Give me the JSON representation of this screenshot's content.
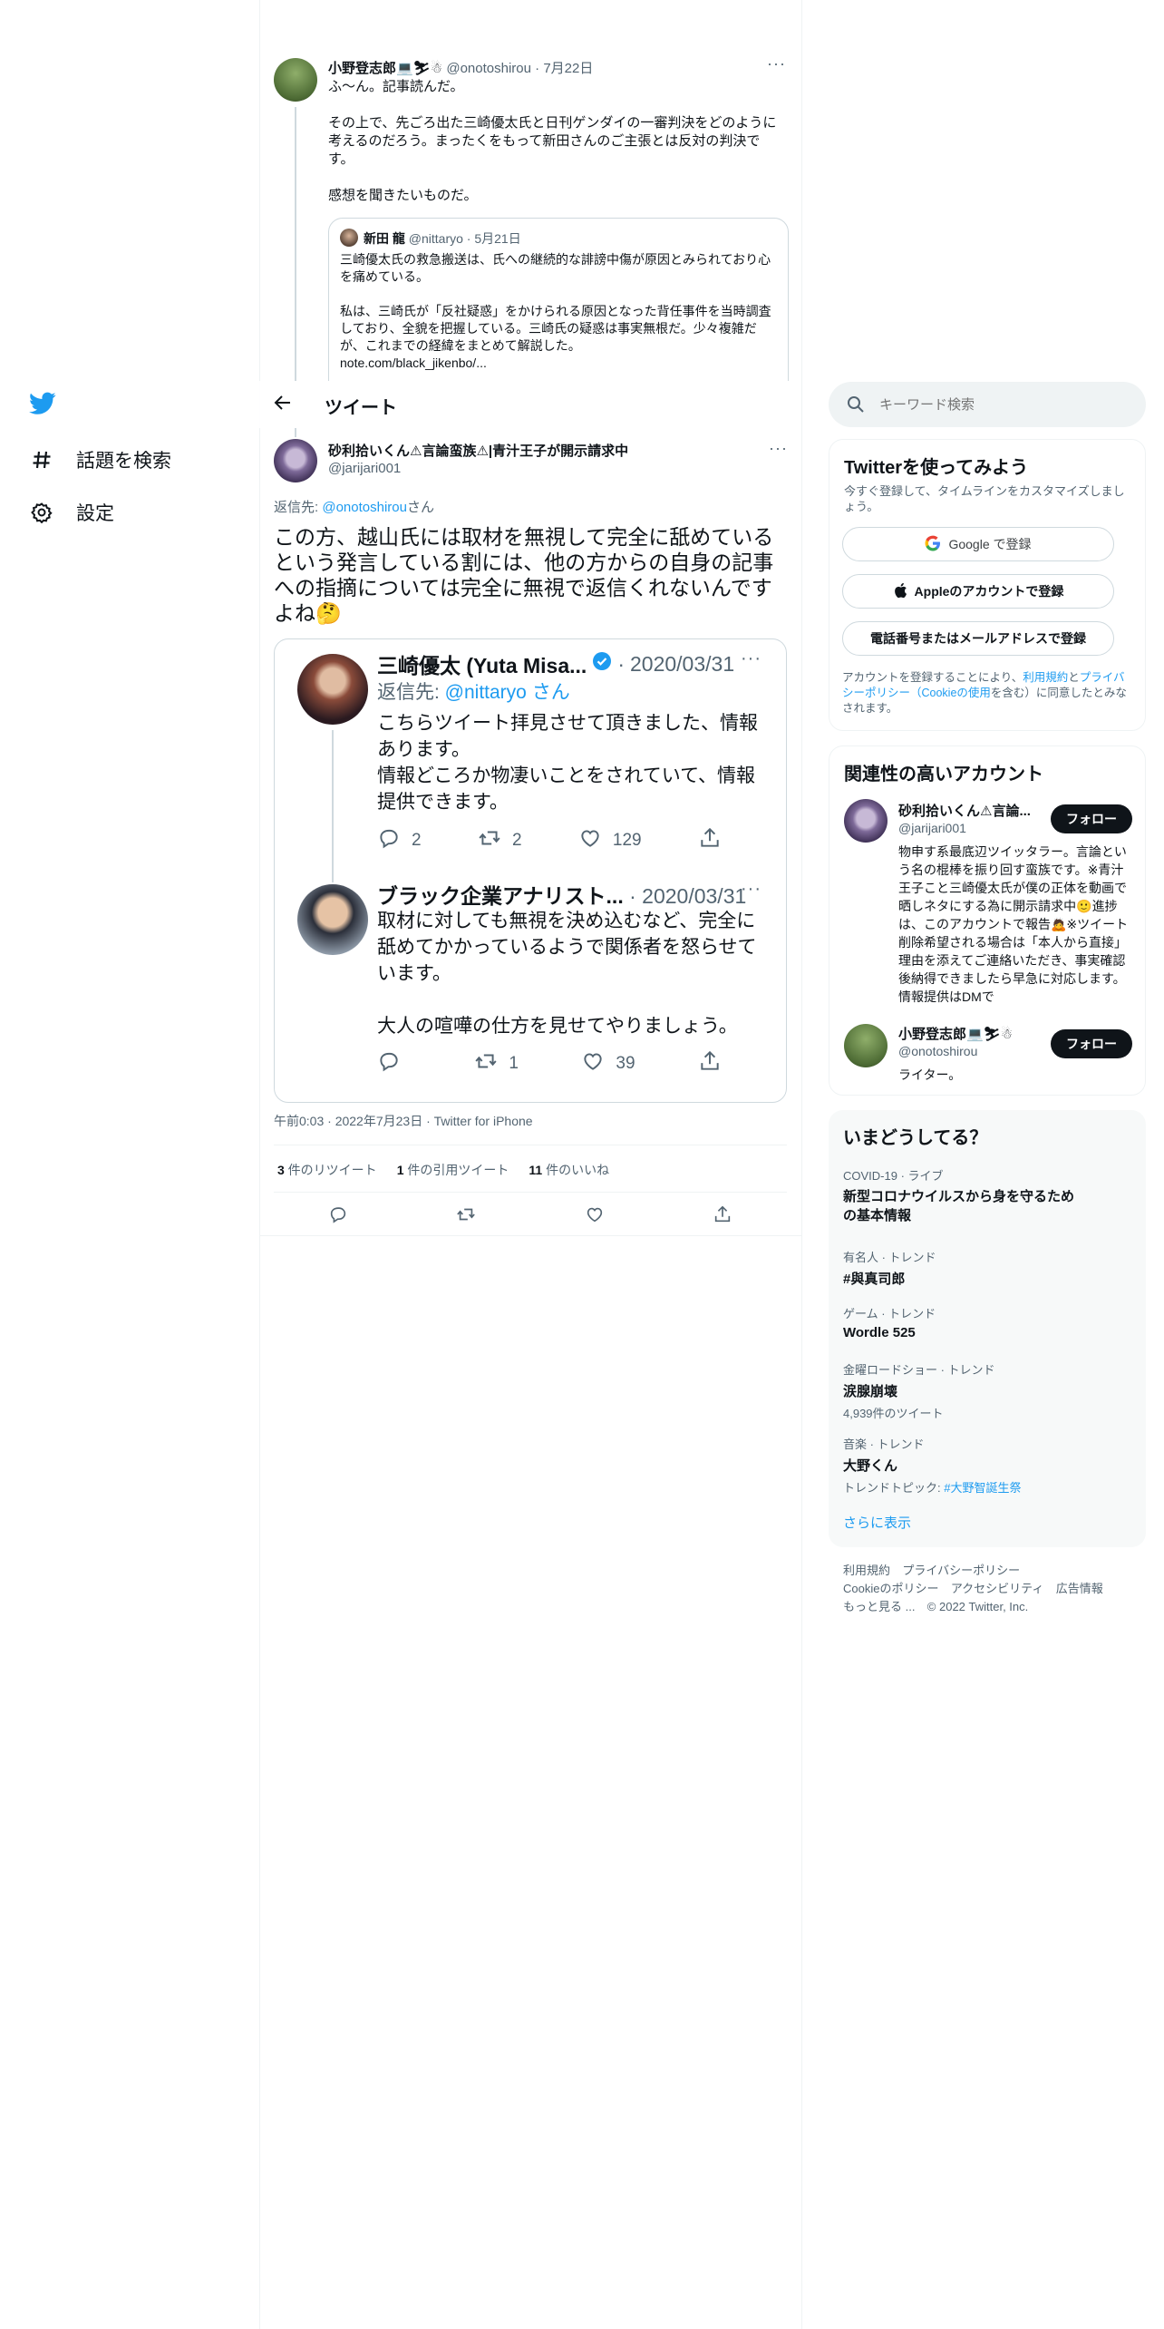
{
  "nav": {
    "logo": "twitter-bird-icon",
    "explore_label": "話題を検索",
    "settings_label": "設定"
  },
  "header": {
    "title": "ツイート"
  },
  "context_tweet": {
    "name": "小野登志郎💻⛷☃",
    "handle": "@onotoshirou",
    "date": "7月22日",
    "text1": "ふ～ん。記事読んだ。",
    "text2": "その上で、先ごろ出た三崎優太氏と日刊ゲンダイの一審判決をどのように考えるのだろう。まったくをもって新田さんのご主張とは反対の判決です。",
    "text3": "感想を聞きたいものだ。",
    "quote": {
      "name": "新田 龍",
      "handle": "@nittaryo",
      "date": "5月21日",
      "text1": "三崎優太氏の救急搬送は、氏への継続的な誹謗中傷が原因とみられており心を痛めている。",
      "text2": "私は、三崎氏が「反社疑惑」をかけられる原因となった背任事件を当時調査しており、全貌を把握している。三崎氏の疑惑は事実無根だ。少々複雑だが、これまでの経緯をまとめて解説した。",
      "link": "note.com/black_jikenbo/..."
    }
  },
  "main_tweet": {
    "name": "砂利拾いくん⚠言論蛮族⚠|青汁王子が開示請求中",
    "handle": "@jarijari001",
    "reply_prefix": "返信先: ",
    "reply_to": "@onotoshirou",
    "reply_suffix": "さん",
    "text": "この方、越山氏には取材を無視して完全に舐めているという発言している割には、他の方からの自身の記事への指摘については完全に無視で返信くれないんですよね🤔",
    "timestamp": "午前0:03 · 2022年7月23日 · Twitter for iPhone",
    "retweets_count": "3",
    "retweets_label": " 件のリツイート",
    "quotes_count": "1",
    "quotes_label": " 件の引用ツイート",
    "likes_count": "11",
    "likes_label": " 件のいいね"
  },
  "embedded": {
    "tweet1": {
      "name": "三崎優太 (Yuta Misa...",
      "date": "2020/03/31",
      "reply_prefix": "返信先: ",
      "reply_to": "@nittaryo さん",
      "text1": "こちらツイート拝見させて頂きました、情報あります。",
      "text2": "情報どころか物凄いことをされていて、情報提供できます。",
      "replies": "2",
      "retweets": "2",
      "likes": "129"
    },
    "tweet2": {
      "name": "ブラック企業アナリスト...",
      "date": "2020/03/31",
      "text1": "取材に対しても無視を決め込むなど、完全に舐めてかかっているようで関係者を怒らせています。",
      "text2": "大人の喧嘩の仕方を見せてやりましょう。",
      "replies": "",
      "retweets": "1",
      "likes": "39"
    }
  },
  "search": {
    "placeholder": "キーワード検索"
  },
  "signup": {
    "title": "Twitterを使ってみよう",
    "subtitle": "今すぐ登録して、タイムラインをカスタマイズしましょう。",
    "google": "Google で登録",
    "apple": "Appleのアカウントで登録",
    "phone": "電話番号またはメールアドレスで登録",
    "legal_1": "アカウントを登録することにより、",
    "legal_terms": "利用規約",
    "legal_2": "と",
    "legal_privacy": "プライバシーポリシー（Cookieの使用",
    "legal_3": "を含む）に同意したとみなされます。"
  },
  "related": {
    "title": "関連性の高いアカウント",
    "follow_label": "フォロー",
    "accounts": [
      {
        "name": "砂利拾いくん⚠言論...",
        "handle": "@jarijari001",
        "bio": "物申す系最底辺ツイッタラー。言論という名の棍棒を振り回す蛮族です。※青汁王子こと三崎優太氏が僕の正体を動画で晒しネタにする為に開示請求中🙂進捗は、このアカウントで報告🙇※ツイート削除希望される場合は「本人から直接」理由を添えてご連絡いただき、事実確認後納得できましたら早急に対応します。情報提供はDMで"
      },
      {
        "name": "小野登志郎💻⛷☃",
        "handle": "@onotoshirou",
        "bio": "ライター。"
      }
    ]
  },
  "trends": {
    "title": "いまどうしてる？",
    "items": [
      {
        "category": "COVID-19 · ライブ",
        "name": "新型コロナウイルスから身を守るための基本情報",
        "meta": ""
      },
      {
        "category": "有名人 · トレンド",
        "name": "#與真司郎",
        "meta": ""
      },
      {
        "category": "ゲーム · トレンド",
        "name": "Wordle 525",
        "meta": ""
      },
      {
        "category": "金曜ロードショー · トレンド",
        "name": "涙腺崩壊",
        "meta": "4,939件のツイート"
      },
      {
        "category": "音楽 · トレンド",
        "name": "大野くん",
        "meta": "トレンドトピック: ",
        "meta_link": "#大野智誕生祭"
      }
    ],
    "show_more": "さらに表示"
  },
  "footer": {
    "row1": [
      "利用規約",
      "プライバシーポリシー"
    ],
    "row2": [
      "Cookieのポリシー",
      "アクセシビリティ",
      "広告情報"
    ],
    "more": "もっと見る ...",
    "copyright": "© 2022 Twitter, Inc."
  }
}
